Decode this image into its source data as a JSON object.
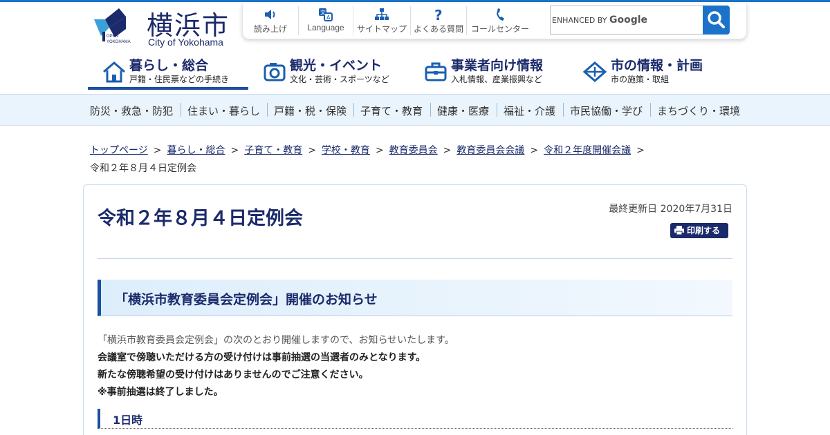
{
  "header": {
    "logo_title": "横浜市",
    "logo_sub": "City of Yokohama",
    "logo_badge": "OPEN YOKOHAMA"
  },
  "toolbar": {
    "items": [
      {
        "label": "読み上げ",
        "icon": "speaker-icon"
      },
      {
        "label": "Language",
        "icon": "translate-icon"
      },
      {
        "label": "サイトマップ",
        "icon": "sitemap-icon"
      },
      {
        "label": "よくある質問",
        "icon": "question-icon"
      },
      {
        "label": "コールセンター",
        "icon": "phone-icon"
      }
    ]
  },
  "search": {
    "enhanced_label": "ENHANCED BY",
    "brand": "Google",
    "button_icon": "search-icon"
  },
  "main_nav": [
    {
      "title": "暮らし・総合",
      "sub": "戸籍・住民票などの手続き",
      "icon": "house-icon",
      "active": true
    },
    {
      "title": "観光・イベント",
      "sub": "文化・芸術・スポーツなど",
      "icon": "camera-icon",
      "active": false
    },
    {
      "title": "事業者向け情報",
      "sub": "入札情報、産業振興など",
      "icon": "toolbox-icon",
      "active": false
    },
    {
      "title": "市の情報・計画",
      "sub": "市の施策・取組",
      "icon": "diamond-icon",
      "active": false
    }
  ],
  "sub_nav": [
    "防災・救急・防犯",
    "住まい・暮らし",
    "戸籍・税・保険",
    "子育て・教育",
    "健康・医療",
    "福祉・介護",
    "市民協働・学び",
    "まちづくり・環境"
  ],
  "breadcrumb": {
    "links": [
      "トップページ",
      "暮らし・総合",
      "子育て・教育",
      "学校・教育",
      "教育委員会",
      "教育委員会会議",
      "令和２年度開催会議"
    ],
    "current": "令和２年８月４日定例会",
    "separator": ">"
  },
  "page": {
    "title": "令和２年８月４日定例会",
    "updated": "最終更新日 2020年7月31日",
    "print_label": "印刷する",
    "section_heading": "「横浜市教育委員会定例会」開催のお知らせ",
    "paragraphs": [
      "「横浜市教育委員会定例会」の次のとおり開催しますので、お知らせいたします。",
      "会議室で傍聴いただける方の受け付けは事前抽選の当選者のみとなります。",
      "新たな傍聴希望の受け付けはありませんのでご注意ください。",
      "※事前抽選は終了しました。"
    ],
    "subheading": "1日時"
  },
  "colors": {
    "brand_navy": "#1b2a6b",
    "accent_blue": "#1a73c8",
    "subnav_bg": "#eaf4fc"
  }
}
